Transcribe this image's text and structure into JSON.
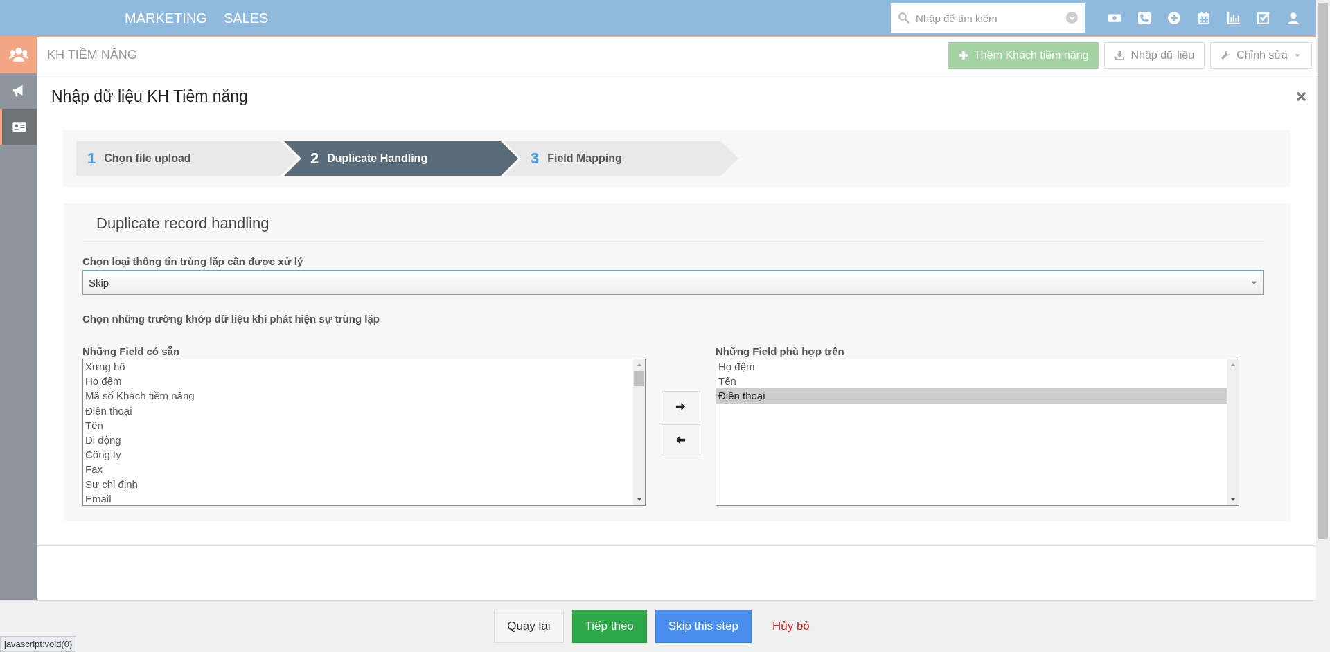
{
  "top_nav": {
    "items": [
      {
        "label": "MARKETING",
        "selected": false
      },
      {
        "label": "SALES",
        "selected": false
      }
    ]
  },
  "search": {
    "placeholder": "Nhập để tìm kiếm"
  },
  "page_header": {
    "title": "KH TIỀM NĂNG",
    "buttons": [
      {
        "label": "Thêm Khách tiềm năng",
        "kind": "primary"
      },
      {
        "label": "Nhập dữ liệu",
        "kind": "import"
      },
      {
        "label": "Chỉnh sửa",
        "kind": "dropdown"
      }
    ]
  },
  "sidebar": {
    "items": [
      {
        "kind": "megaphone",
        "selected": false
      },
      {
        "kind": "contact-card",
        "selected": true
      }
    ]
  },
  "dialog": {
    "title": "Nhập dữ liệu KH Tiềm năng",
    "steps": [
      {
        "number": "1",
        "label": "Chọn file upload",
        "selected": false
      },
      {
        "number": "2",
        "label": "Duplicate Handling",
        "selected": true
      },
      {
        "number": "3",
        "label": "Field Mapping",
        "selected": false
      }
    ],
    "section_title": "Duplicate record handling",
    "duplicate_type": {
      "label": "Chọn loại thông tin trùng lặp cần được xử lý",
      "value": "Skip"
    },
    "match_label": "Chọn những trường khớp dữ liệu khi phát hiện sự trùng lặp",
    "available_fields": {
      "label": "Những Field có sẵn",
      "items": [
        {
          "label": "Xưng hô",
          "selected": false
        },
        {
          "label": "Họ đệm",
          "selected": false
        },
        {
          "label": "Mã số Khách tiềm năng",
          "selected": false
        },
        {
          "label": "Điện thoại",
          "selected": false
        },
        {
          "label": "Tên",
          "selected": false
        },
        {
          "label": "Di động",
          "selected": false
        },
        {
          "label": "Công ty",
          "selected": false
        },
        {
          "label": "Fax",
          "selected": false
        },
        {
          "label": "Sự chỉ định",
          "selected": false
        },
        {
          "label": "Email",
          "selected": false
        }
      ]
    },
    "matched_fields": {
      "label": "Những Field phù hợp trên",
      "items": [
        {
          "label": "Họ đệm",
          "selected": false
        },
        {
          "label": "Tên",
          "selected": false
        },
        {
          "label": "Điện thoại",
          "selected": true
        }
      ]
    },
    "footer_buttons": [
      {
        "label": "Quay lại",
        "kind": "default"
      },
      {
        "label": "Tiếp theo",
        "kind": "success"
      },
      {
        "label": "Skip this step",
        "kind": "primary"
      },
      {
        "label": "Hủy bỏ",
        "kind": "link"
      }
    ]
  },
  "status_bar": {
    "text": "javascript:void(0)"
  }
}
